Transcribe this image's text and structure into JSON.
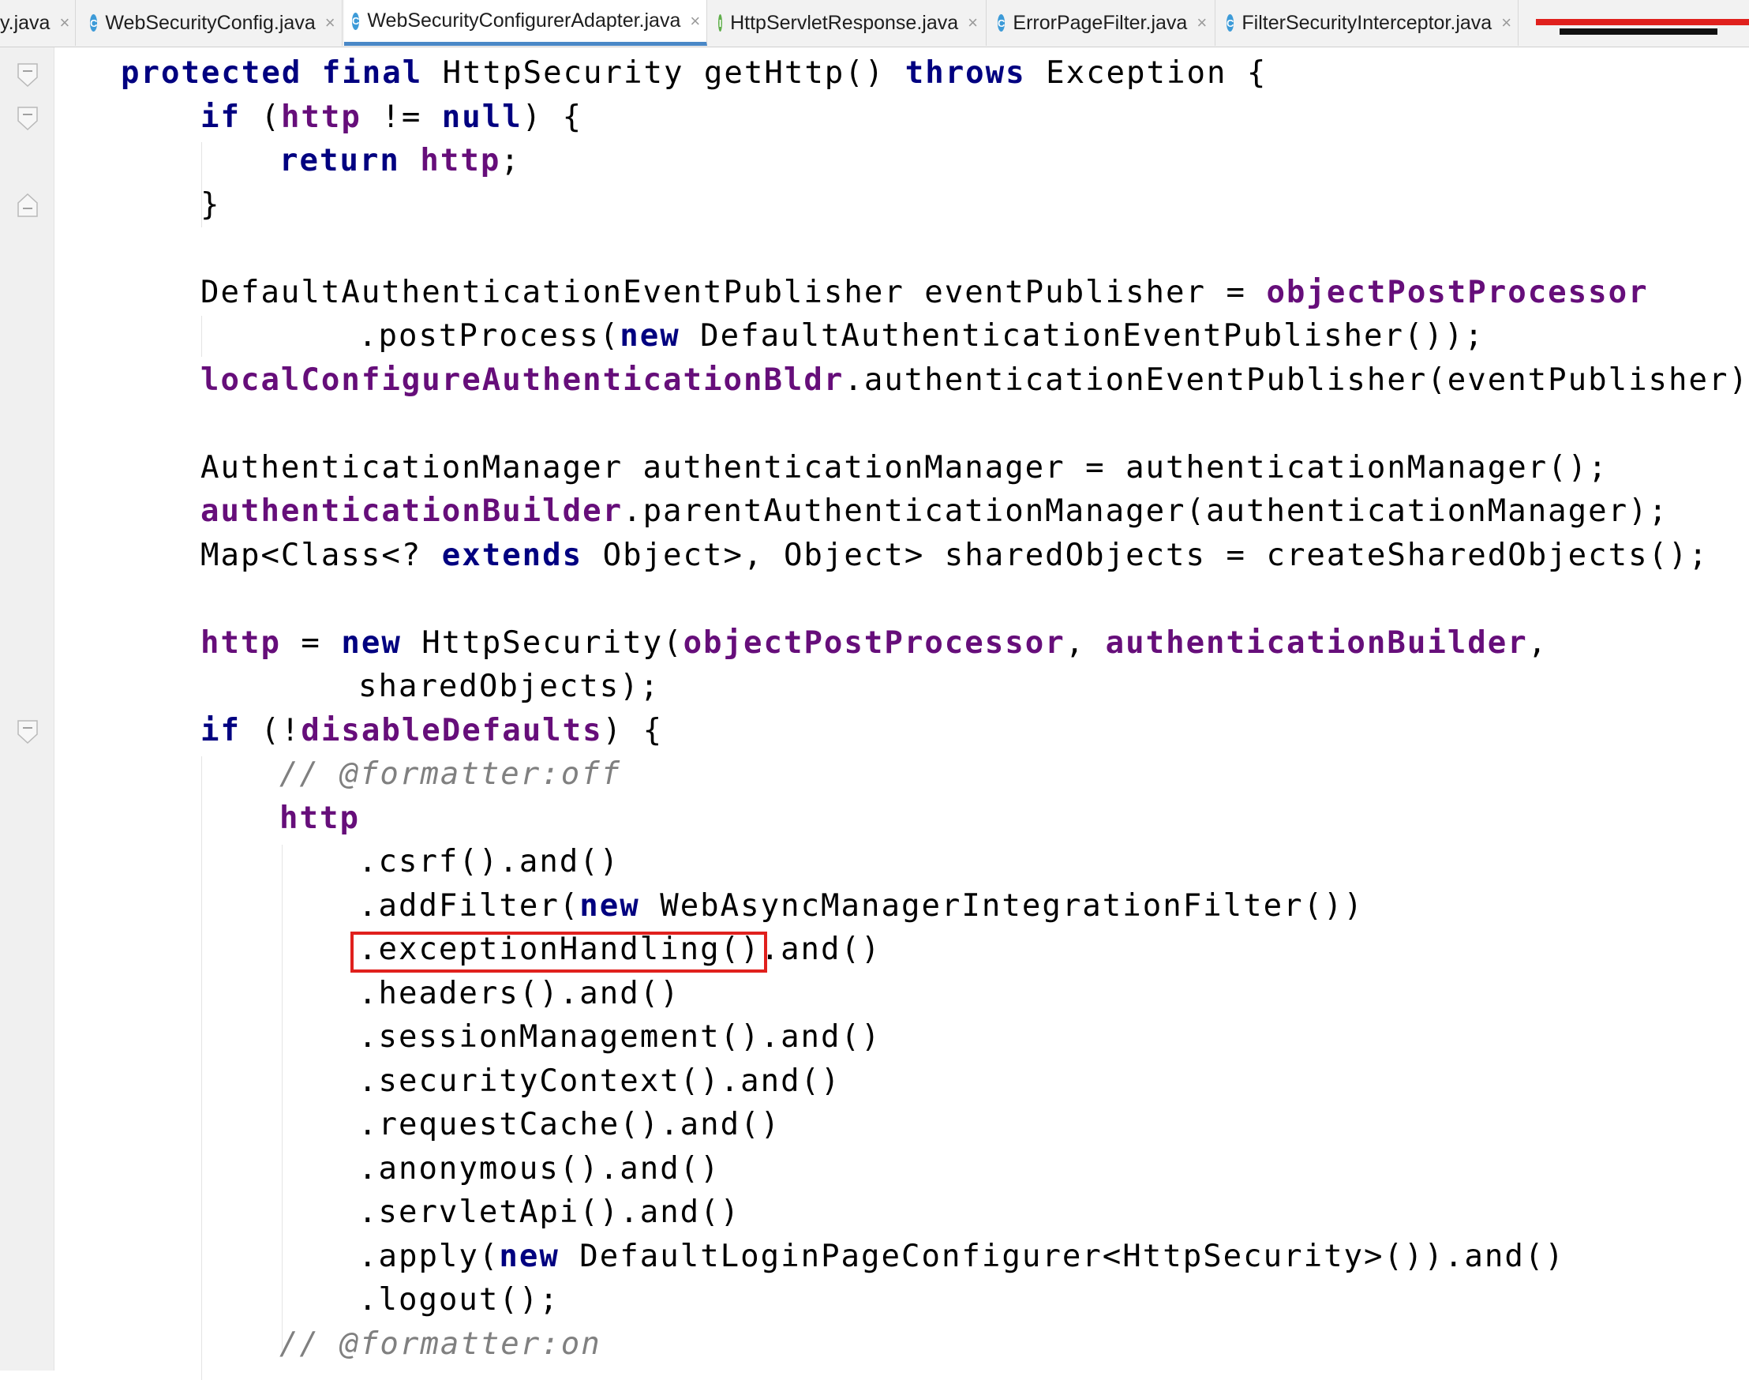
{
  "tabs": [
    {
      "label": "y.java",
      "icon": "none",
      "active": false
    },
    {
      "label": "WebSecurityConfig.java",
      "icon": "class-icon",
      "active": false
    },
    {
      "label": "WebSecurityConfigurerAdapter.java",
      "icon": "class-icon",
      "active": true
    },
    {
      "label": "HttpServletResponse.java",
      "icon": "interface-icon",
      "active": false
    },
    {
      "label": "ErrorPageFilter.java",
      "icon": "class-icon",
      "active": false
    },
    {
      "label": "FilterSecurityInterceptor.java",
      "icon": "class-icon",
      "active": false
    }
  ],
  "tab_close_glyph": "×",
  "code": {
    "l1": {
      "kw1": "protected final",
      "t1": " HttpSecurity getHttp() ",
      "kw2": "throws",
      "t2": " Exception {"
    },
    "l2": {
      "kw1": "if",
      "t1": " (",
      "kw2": "http",
      "t2": " != ",
      "kw3": "null",
      "t3": ") {"
    },
    "l3": {
      "kw1": "return",
      "t1": " ",
      "kw2": "http",
      "t2": ";"
    },
    "l4": "}",
    "l5": {
      "t1": "DefaultAuthenticationEventPublisher eventPublisher = ",
      "f1": "objectPostProcessor"
    },
    "l6": {
      "t1": ".postProcess(",
      "kw1": "new",
      "t2": " DefaultAuthenticationEventPublisher());"
    },
    "l7": {
      "f1": "localConfigureAuthenticationBldr",
      "t1": ".authenticationEventPublisher(eventPublisher);"
    },
    "l8": "AuthenticationManager authenticationManager = authenticationManager();",
    "l9": {
      "f1": "authenticationBuilder",
      "t1": ".parentAuthenticationManager(authenticationManager);"
    },
    "l10": {
      "t1": "Map<Class<? ",
      "kw1": "extends",
      "t2": " Object>, Object> sharedObjects = createSharedObjects();"
    },
    "l11": {
      "f1": "http",
      "t1": " = ",
      "kw1": "new",
      "t2": " HttpSecurity(",
      "f2": "objectPostProcessor",
      "t3": ", ",
      "f3": "authenticationBuilder",
      "t4": ","
    },
    "l12": "sharedObjects);",
    "l13": {
      "kw1": "if",
      "t1": " (!",
      "f1": "disableDefaults",
      "t2": ") {"
    },
    "l14": "// @formatter:off",
    "l15": {
      "kw1": "http"
    },
    "l16": ".csrf().and()",
    "l17": {
      "t1": ".addFilter(",
      "kw1": "new",
      "t2": " WebAsyncManagerIntegrationFilter())"
    },
    "l18": ".exceptionHandling().and()",
    "l19": ".headers().and()",
    "l20": ".sessionManagement().and()",
    "l21": ".securityContext().and()",
    "l22": ".requestCache().and()",
    "l23": ".anonymous().and()",
    "l24": ".servletApi().and()",
    "l25": {
      "t1": ".apply(",
      "kw1": "new",
      "t2": " DefaultLoginPageConfigurer<HttpSecurity>()).and()"
    },
    "l26": ".logout();",
    "l27": "// @formatter:on"
  },
  "colors": {
    "keyword": "#000080",
    "field": "#660e7a",
    "comment": "#808080",
    "highlight_border": "#e0201d",
    "active_tab_underline": "#4a88c7"
  }
}
